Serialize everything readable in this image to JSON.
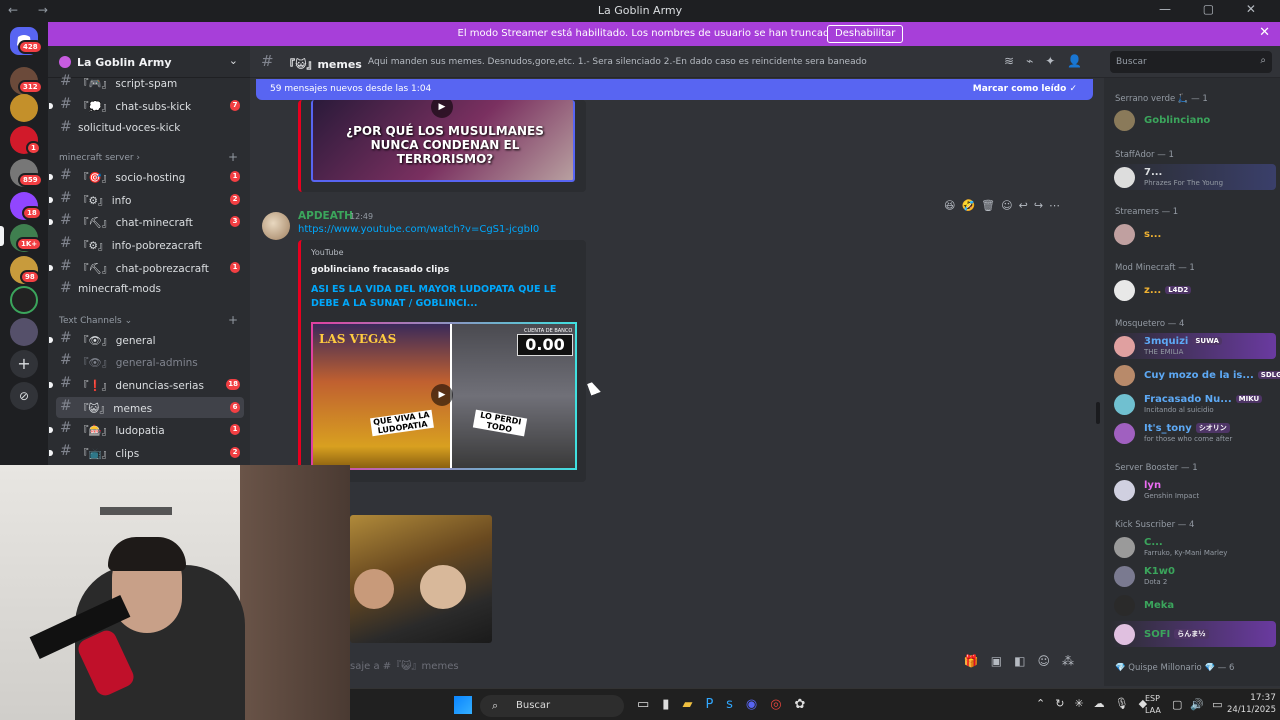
{
  "window": {
    "title": "La Goblin Army",
    "nav": "← →",
    "controls": "— ▢ ✕"
  },
  "banner": {
    "message": "El modo Streamer está habilitado. Los nombres de usuario se han truncado.",
    "button": "Deshabilitar",
    "close": "✕"
  },
  "rail": {
    "badges": [
      "428",
      "312",
      "1",
      "859",
      "18",
      "1K+",
      "98"
    ]
  },
  "sidebar": {
    "server_name": "La Goblin Army",
    "channels_top": [
      {
        "prefix": "『🎮』",
        "name": "script-spam",
        "count": ""
      },
      {
        "prefix": "『💭』",
        "name": "chat-subs-kick",
        "count": "7"
      },
      {
        "prefix": "",
        "name": "solicitud-voces-kick",
        "count": ""
      }
    ],
    "category_minecraft": "minecraft server",
    "channels_minecraft": [
      {
        "prefix": "『🎯』",
        "name": "socio-hosting",
        "count": "1"
      },
      {
        "prefix": "『⚙』",
        "name": "info",
        "count": "2"
      },
      {
        "prefix": "『⛏』",
        "name": "chat-minecraft",
        "count": "3"
      },
      {
        "prefix": "『⚙』",
        "name": "info-pobrezacraft",
        "count": ""
      },
      {
        "prefix": "『⛏』",
        "name": "chat-pobrezacraft",
        "count": "1"
      },
      {
        "prefix": "",
        "name": "minecraft-mods",
        "count": ""
      }
    ],
    "category_text": "Text Channels",
    "channels_text": [
      {
        "prefix": "『👁』",
        "name": "general",
        "count": ""
      },
      {
        "prefix": "『👁』",
        "name": "general-admins",
        "count": ""
      },
      {
        "prefix": "『❗』",
        "name": "denuncias-serias",
        "count": "18"
      },
      {
        "prefix": "『😺』",
        "name": "memes",
        "count": "6"
      },
      {
        "prefix": "『🎰』",
        "name": "ludopatia",
        "count": "1"
      },
      {
        "prefix": "『📺』",
        "name": "clips",
        "count": "2"
      }
    ]
  },
  "channel_header": {
    "name": "『😺』memes",
    "topic": "Aqui manden sus memes. Desnudos,gore,etc. 1.- Sera silenciado 2.-En dado caso es reincidente sera baneado",
    "search_placeholder": "Buscar"
  },
  "new_messages_bar": {
    "text": "59 mensajes nuevos desde las 1:04",
    "action": "Marcar como leído"
  },
  "messages": {
    "first_thumb_caption": "¿POR QUÉ LOS MUSULMANES NUNCA CONDENAN EL TERRORISMO?",
    "author": "APDEATH",
    "time": "12:49",
    "link": "https://www.youtube.com/watch?v=CgS1-jcgbI0",
    "embed_provider": "YouTube",
    "embed_author": "goblinciano fracasado clips",
    "embed_title": "ASI ES LA VIDA DEL MAYOR LUDOPATA QUE LE DEBE A LA SUNAT / GOBLINCI...",
    "thumb_left_title": "LAS VEGAS",
    "thumb_left_caption": "QUE VIVA LA LUDOPATIA",
    "thumb_right_label": "CUENTA DE BANCO",
    "thumb_right_value": "0.00",
    "thumb_right_caption": "LO PERDI TODO"
  },
  "composer": {
    "placeholder": "saje a #『😺』memes"
  },
  "members": {
    "roles": [
      {
        "label": "Serrano verde 🛴 — 1"
      },
      {
        "label": "StaffAdor — 1"
      },
      {
        "label": "Streamers — 1"
      },
      {
        "label": "Mod Minecraft — 1"
      },
      {
        "label": "Mosquetero — 4"
      },
      {
        "label": "Server Booster — 1"
      },
      {
        "label": "Kick Suscriber — 4"
      },
      {
        "label": "💎 Quispe Millonario 💎 — 6"
      }
    ],
    "list": [
      {
        "name": "Goblinciano",
        "status": "",
        "tag": "",
        "color": "#3ba55c"
      },
      {
        "name": "7...",
        "status": "Phrazes For The Young",
        "tag": "",
        "color": "#dbdee1"
      },
      {
        "name": "s...",
        "status": "",
        "tag": "",
        "color": "#f0b232"
      },
      {
        "name": "z...",
        "status": "",
        "tag": "L4D2",
        "color": "#f0b232"
      },
      {
        "name": "3mquizi",
        "status": "THE EMILIA",
        "tag": "SUWA",
        "color": "#5da9f5"
      },
      {
        "name": "Cuy mozo de la is...",
        "status": "",
        "tag": "SDLG",
        "color": "#5da9f5"
      },
      {
        "name": "Fracasado Nu...",
        "status": "Incitando al suicidio",
        "tag": "MIKU",
        "color": "#5da9f5"
      },
      {
        "name": "It's_tony",
        "status": "for those who come after",
        "tag": "シオリン",
        "color": "#5da9f5"
      },
      {
        "name": "lyn",
        "status": "Genshin Impact",
        "tag": "",
        "color": "#eb6cf2"
      },
      {
        "name": "C...",
        "status": "Farruko, Ky-Mani Marley",
        "tag": "",
        "color": "#3ba55c"
      },
      {
        "name": "K1w0",
        "status": "Dota 2",
        "tag": "",
        "color": "#3ba55c"
      },
      {
        "name": "Meka",
        "status": "",
        "tag": "",
        "color": "#3ba55c"
      },
      {
        "name": "SOFI",
        "status": "",
        "tag": "らんま½",
        "color": "#3ba55c"
      }
    ]
  },
  "taskbar": {
    "search": "Buscar",
    "lang_top": "ESP",
    "lang_bottom": "LAA",
    "time": "17:37",
    "date": "24/11/2025"
  },
  "colors": {
    "accent": "#5865f2",
    "banner": "#a73fd9",
    "mention_red": "#f23f43",
    "author": "#3ba55c"
  }
}
